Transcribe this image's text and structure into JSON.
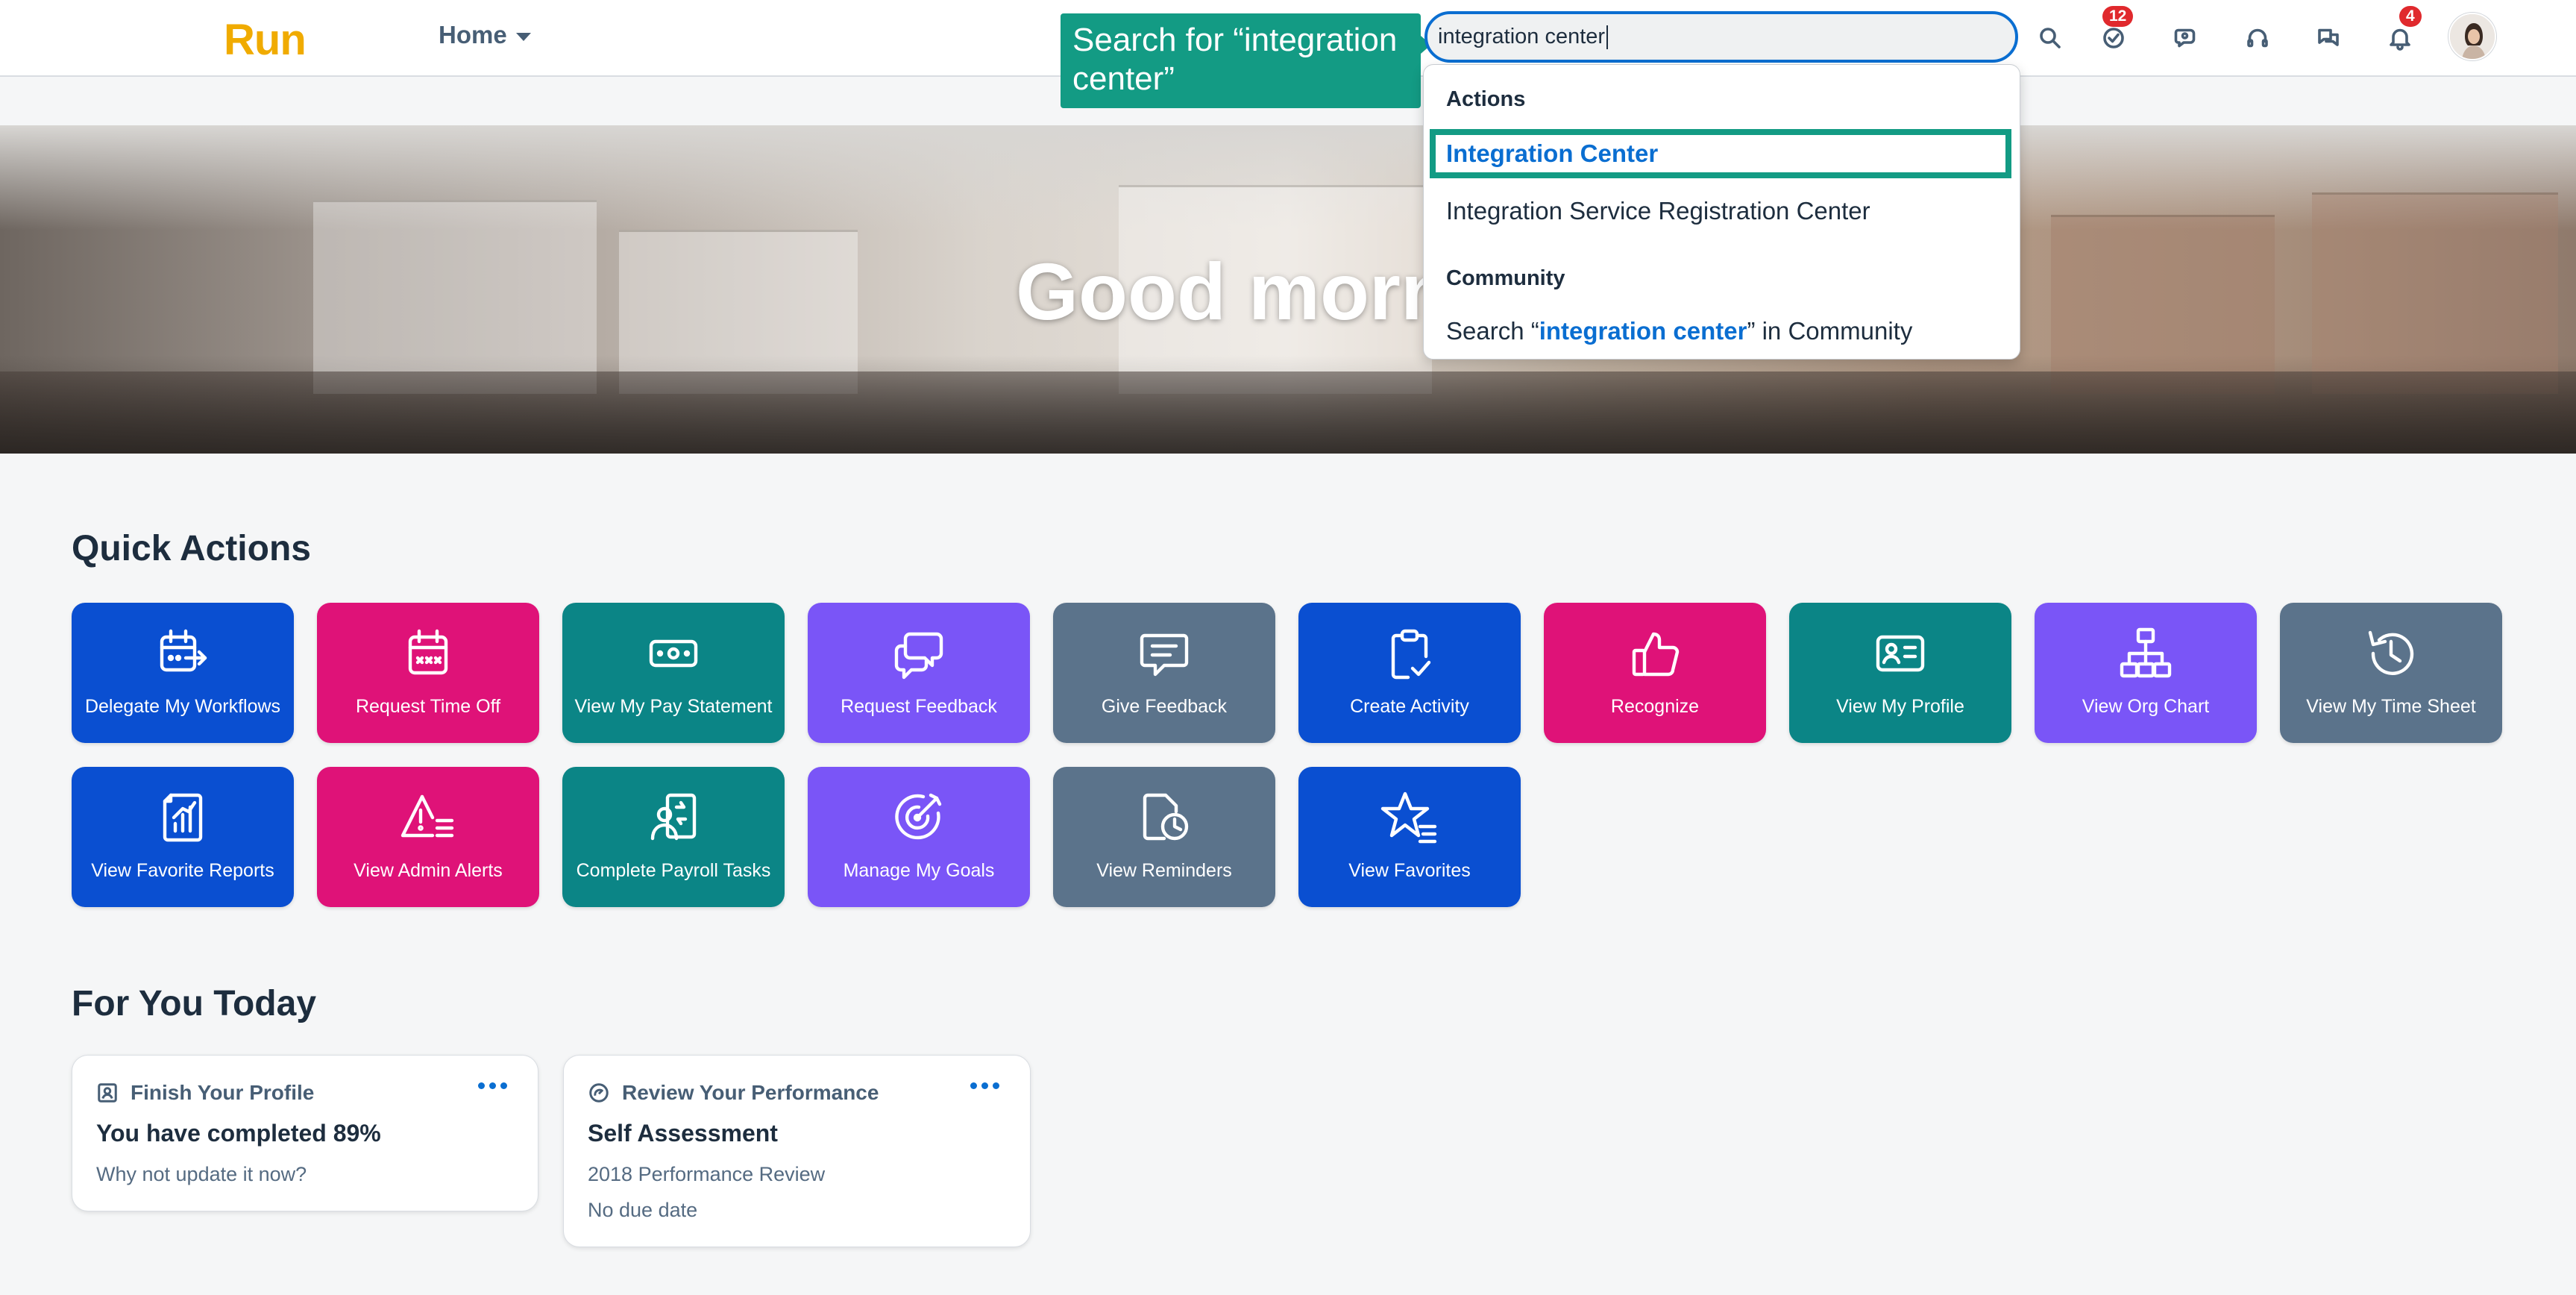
{
  "header": {
    "logo": "Run",
    "home_label": "Home",
    "search_value": "integration center",
    "badges": {
      "tasks": "12",
      "notifications": "4"
    },
    "icons": [
      "search-icon",
      "tasks-icon",
      "chat-icon",
      "headset-icon",
      "feedback-icon",
      "bell-icon"
    ]
  },
  "callout": {
    "text": "Search for “integration center”"
  },
  "dropdown": {
    "actions_title": "Actions",
    "items": [
      "Integration Center",
      "Integration Service Registration Center"
    ],
    "community_title": "Community",
    "community": {
      "prefix": "Search “",
      "term": "integration center",
      "suffix": "” in Community"
    }
  },
  "banner": {
    "greeting": "Good morn"
  },
  "quick_actions": {
    "title": "Quick Actions",
    "tiles": [
      {
        "label": "Delegate My Workflows",
        "icon": "delegate-icon",
        "color": "#0a4fd1"
      },
      {
        "label": "Request Time Off",
        "icon": "calendar-icon",
        "color": "#df1278"
      },
      {
        "label": "View My Pay Statement",
        "icon": "money-icon",
        "color": "#0b8586"
      },
      {
        "label": "Request Feedback",
        "icon": "speech-bubbles-icon",
        "color": "#7a55f7"
      },
      {
        "label": "Give Feedback",
        "icon": "message-icon",
        "color": "#5b738b"
      },
      {
        "label": "Create Activity",
        "icon": "clipboard-check-icon",
        "color": "#0a4fd1"
      },
      {
        "label": "Recognize",
        "icon": "thumbs-up-icon",
        "color": "#df1278"
      },
      {
        "label": "View My Profile",
        "icon": "id-card-icon",
        "color": "#0b8586"
      },
      {
        "label": "View Org Chart",
        "icon": "org-chart-icon",
        "color": "#7a55f7"
      },
      {
        "label": "View My Time Sheet",
        "icon": "history-icon",
        "color": "#5b738b"
      },
      {
        "label": "View Favorite Reports",
        "icon": "report-icon",
        "color": "#0a4fd1"
      },
      {
        "label": "View Admin Alerts",
        "icon": "alert-list-icon",
        "color": "#df1278"
      },
      {
        "label": "Complete Payroll Tasks",
        "icon": "payroll-icon",
        "color": "#0b8586"
      },
      {
        "label": "Manage My Goals",
        "icon": "target-icon",
        "color": "#7a55f7"
      },
      {
        "label": "View Reminders",
        "icon": "reminder-icon",
        "color": "#5b738b"
      },
      {
        "label": "View Favorites",
        "icon": "star-list-icon",
        "color": "#0a4fd1"
      }
    ]
  },
  "for_you": {
    "title": "For You Today",
    "cards": [
      {
        "header": "Finish Your Profile",
        "title": "You have completed 89%",
        "lines": [
          "Why not update it now?"
        ]
      },
      {
        "header": "Review Your Performance",
        "title": "Self Assessment",
        "lines": [
          "2018 Performance Review",
          "No due date"
        ]
      }
    ]
  }
}
